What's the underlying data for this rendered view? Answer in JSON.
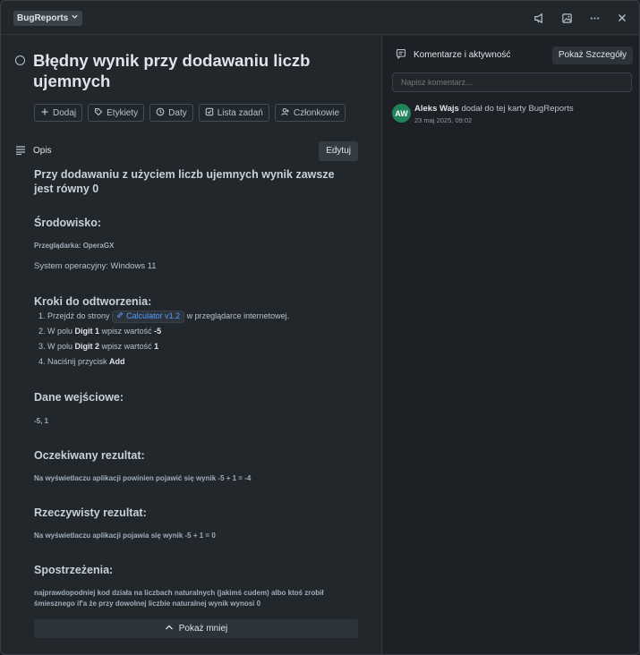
{
  "topbar": {
    "board_name": "BugReports",
    "icons": [
      "chevron-down-icon",
      "megaphone-icon",
      "image-icon",
      "more-icon",
      "close-icon"
    ]
  },
  "card": {
    "title": "Błędny wynik przy dodawaniu liczb ujemnych",
    "actions": [
      {
        "label": "Dodaj",
        "icon": "plus-icon"
      },
      {
        "label": "Etykiety",
        "icon": "tag-icon"
      },
      {
        "label": "Daty",
        "icon": "clock-icon"
      },
      {
        "label": "Lista zadań",
        "icon": "checklist-icon"
      },
      {
        "label": "Członkowie",
        "icon": "members-icon"
      }
    ]
  },
  "description": {
    "label": "Opis",
    "edit_label": "Edytuj",
    "lead": "Przy dodawaniu z użyciem liczb ujemnych wynik zawsze jest równy 0",
    "env_heading": "Środowisko:",
    "browser": "Przeglądarka: OperaGX",
    "os": "System operacyjny: Windows 11",
    "steps_heading": "Kroki do odtworzenia:",
    "step1_pre": "1. Przejdź do strony",
    "step1_link": "Calculator v1.2",
    "step1_post": "w przeglądarce internetowej.",
    "step2_pre": "2. W polu",
    "step2_b1": "Digit 1",
    "step2_mid": "wpisz wartość",
    "step2_b2": "-5",
    "step3_pre": "3. W polu",
    "step3_b1": "Digit 2",
    "step3_mid": "wpisz wartość",
    "step3_b2": "1",
    "step4_pre": "4. Naciśnij przycisk",
    "step4_b": "Add",
    "input_heading": "Dane wejściowe:",
    "input_value": "-5, 1",
    "expected_heading": "Oczekiwany rezultat:",
    "expected_value": "Na wyświetlaczu aplikacji powinien pojawić się wynik -5 + 1 = -4",
    "actual_heading": "Rzeczywisty rezultat:",
    "actual_value": "Na wyświetlaczu aplikacji pojawia się wynik -5 + 1 = 0",
    "notes_heading": "Spostrzeżenia:",
    "notes_line1": "najprawdopodniej kod działa na liczbach naturalnych (jakimś cudem) albo ktoś zrobił",
    "notes_line2": "śmiesznego if'a że przy dowolnej liczbie naturalnej wynik wynosi 0",
    "show_less": "Pokaż mniej"
  },
  "activity_panel": {
    "title": "Komentarze i aktywność",
    "details_button": "Pokaż Szczegóły",
    "comment_placeholder": "Napisz komentarz...",
    "entries": [
      {
        "initials": "AW",
        "user": "Aleks Wajs",
        "action": "dodał do tej karty BugReports",
        "time": "23 maj 2025, 09:02"
      }
    ]
  },
  "colors": {
    "background": "#22272b",
    "panel": "#1d2125",
    "text": "#b6c2cf",
    "link": "#579dff",
    "avatar": "#1f845a"
  }
}
